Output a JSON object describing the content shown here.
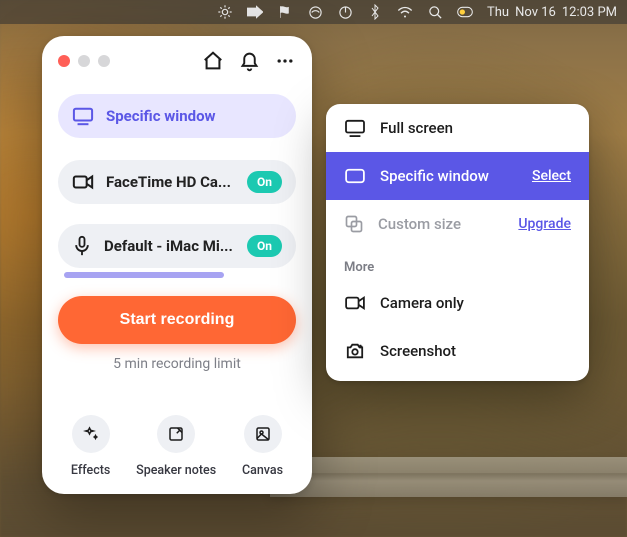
{
  "menubar": {
    "day": "Thu",
    "date": "Nov 16",
    "time": "12:03 PM"
  },
  "panel": {
    "mode_label": "Specific window",
    "camera_label": "FaceTime HD Ca...",
    "camera_badge": "On",
    "mic_label": "Default - iMac Mi...",
    "mic_badge": "On",
    "record_label": "Start recording",
    "limit_label": "5 min recording limit",
    "tools": {
      "effects": "Effects",
      "notes": "Speaker notes",
      "canvas": "Canvas"
    }
  },
  "popover": {
    "full_screen": "Full screen",
    "specific_window": "Specific window",
    "select": "Select",
    "custom_size": "Custom size",
    "upgrade": "Upgrade",
    "more": "More",
    "camera_only": "Camera only",
    "screenshot": "Screenshot"
  }
}
